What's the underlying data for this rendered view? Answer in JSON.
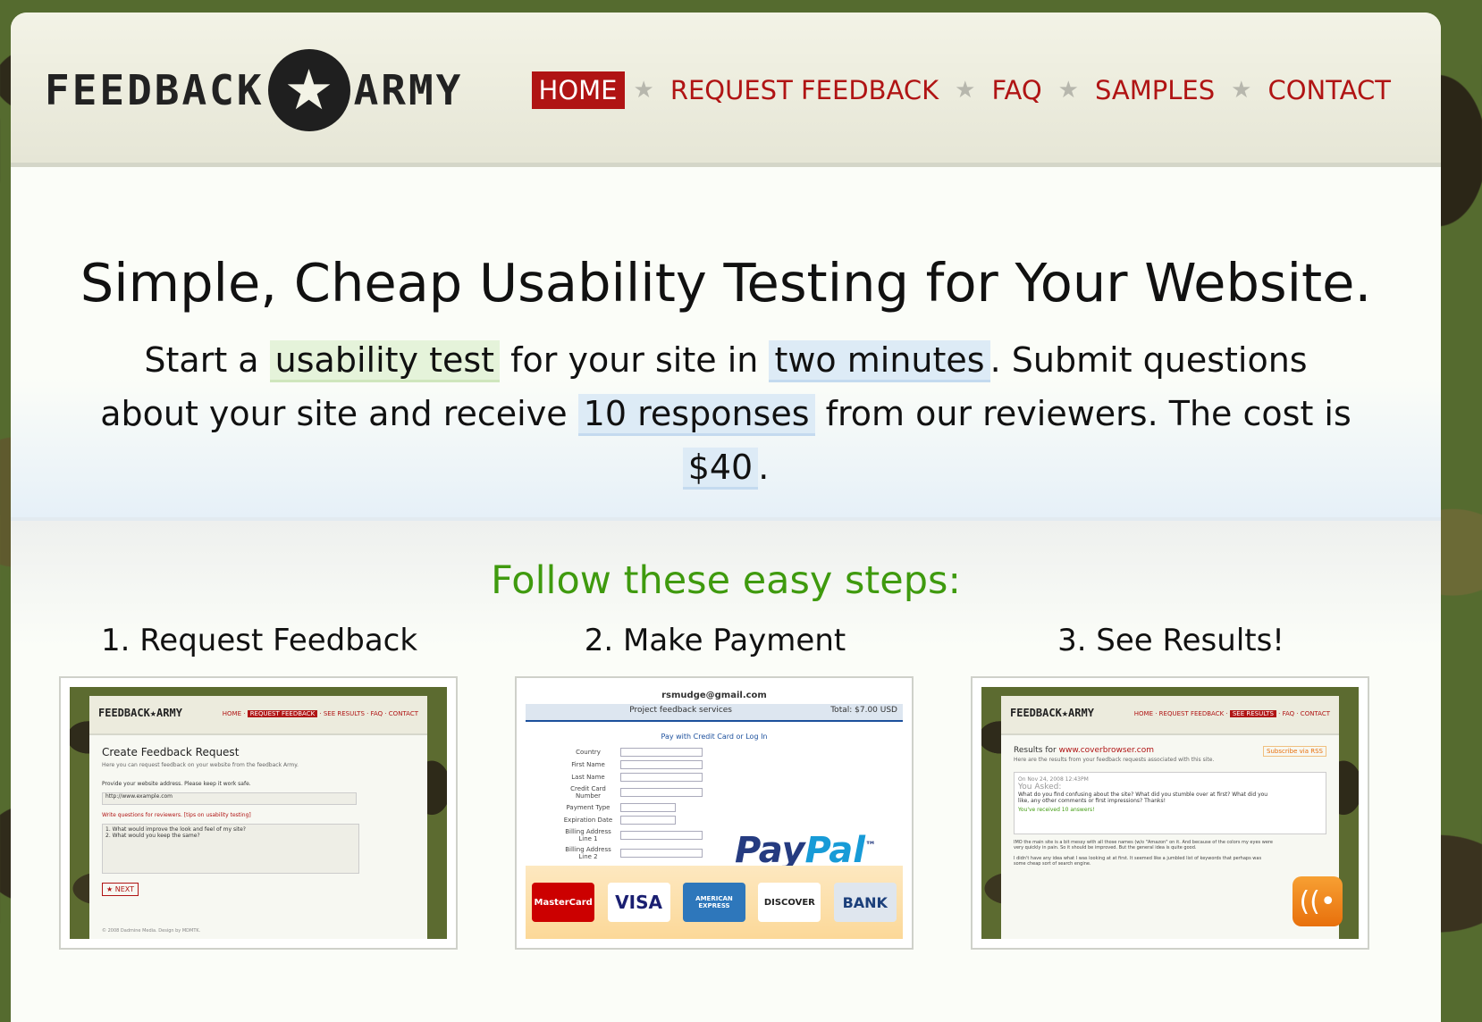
{
  "logo": {
    "text_left": "FEEDBACK",
    "text_right": "ARMY",
    "star": "★"
  },
  "nav": {
    "items": [
      "HOME",
      "REQUEST FEEDBACK",
      "FAQ",
      "SAMPLES",
      "CONTACT"
    ],
    "separator": "★"
  },
  "hero": {
    "title": "Simple, Cheap Usability Testing for Your Website.",
    "p1": "Start a ",
    "hl1": "usability test",
    "p2": " for your site in ",
    "hl2": "two minutes",
    "p3": ". Submit questions about your site and receive ",
    "hl3": "10 responses",
    "p4": " from our reviewers. The cost is ",
    "hl4": "$40",
    "p5": "."
  },
  "steps": {
    "heading": "Follow these easy steps:",
    "items": [
      {
        "title": "1. Request Feedback"
      },
      {
        "title": "2. Make Payment"
      },
      {
        "title": "3. See Results!"
      }
    ]
  },
  "shot1": {
    "logo": "FEEDBACK★ARMY",
    "nav_pre": "HOME · ",
    "nav_active": "REQUEST FEEDBACK",
    "nav_post": " · SEE RESULTS · FAQ · CONTACT",
    "heading": "Create Feedback Request",
    "intro": "Here you can request feedback on your website from the feedback Army.",
    "url_label": "Provide your website address. Please keep it work safe.",
    "url_value": "http://www.example.com",
    "q_label": "Write questions for reviewers. [tips on usability testing]",
    "q1": "1. What would improve the look and feel of my site?",
    "q2": "2. What would you keep the same?",
    "next": "★ NEXT",
    "footer": "© 2008 Dadmine Media. Design by MDMTK."
  },
  "shot2": {
    "email": "rsmudge@gmail.com",
    "bar_left": "Project feedback services",
    "bar_right": "Total: $7.00 USD",
    "pay_heading": "Pay with Credit Card or Log In",
    "fields": [
      "Country",
      "First Name",
      "Last Name",
      "Credit Card Number",
      "Payment Type",
      "Expiration Date",
      "Billing Address Line 1",
      "Billing Address Line 2"
    ],
    "paypal_a": "Pay",
    "paypal_b": "Pal",
    "tm": "™",
    "cards": [
      "MasterCard",
      "VISA",
      "AMERICAN EXPRESS",
      "DISCOVER",
      "BANK"
    ]
  },
  "shot3": {
    "logo": "FEEDBACK★ARMY",
    "nav_pre": "HOME · REQUEST FEEDBACK · ",
    "nav_active": "SEE RESULTS",
    "nav_post": " · FAQ · CONTACT",
    "results_pre": "Results for ",
    "results_site": "www.coverbrowser.com",
    "subscribe": "Subscribe via RSS",
    "intro": "Here are the results from your feedback requests associated with this site.",
    "date": "On Nov 24, 2008 12:43PM",
    "asked": "You Asked:",
    "question": "What do you find confusing about the site? What did you stumble over at first? What did you like, any other comments or first impressions? Thanks!",
    "received": "You've received 10 answers!",
    "answer1": "IMO the main site is a bit messy with all those names (w/o \"Amazon\" on it. And because of the colors my eyes were very quickly in pain. So it should be improved. But the general idea is quite good.",
    "answer2": "I didn't have any idea what I was looking at at first. It seemed like a jumbled list of keywords that perhaps was some cheap sort of search engine.",
    "rss_icon": "((•"
  },
  "colors": {
    "nav_red": "#b01414",
    "steps_green": "#3f9a0e",
    "highlight_green": "#e5f3da",
    "highlight_blue": "#ddebf6"
  }
}
